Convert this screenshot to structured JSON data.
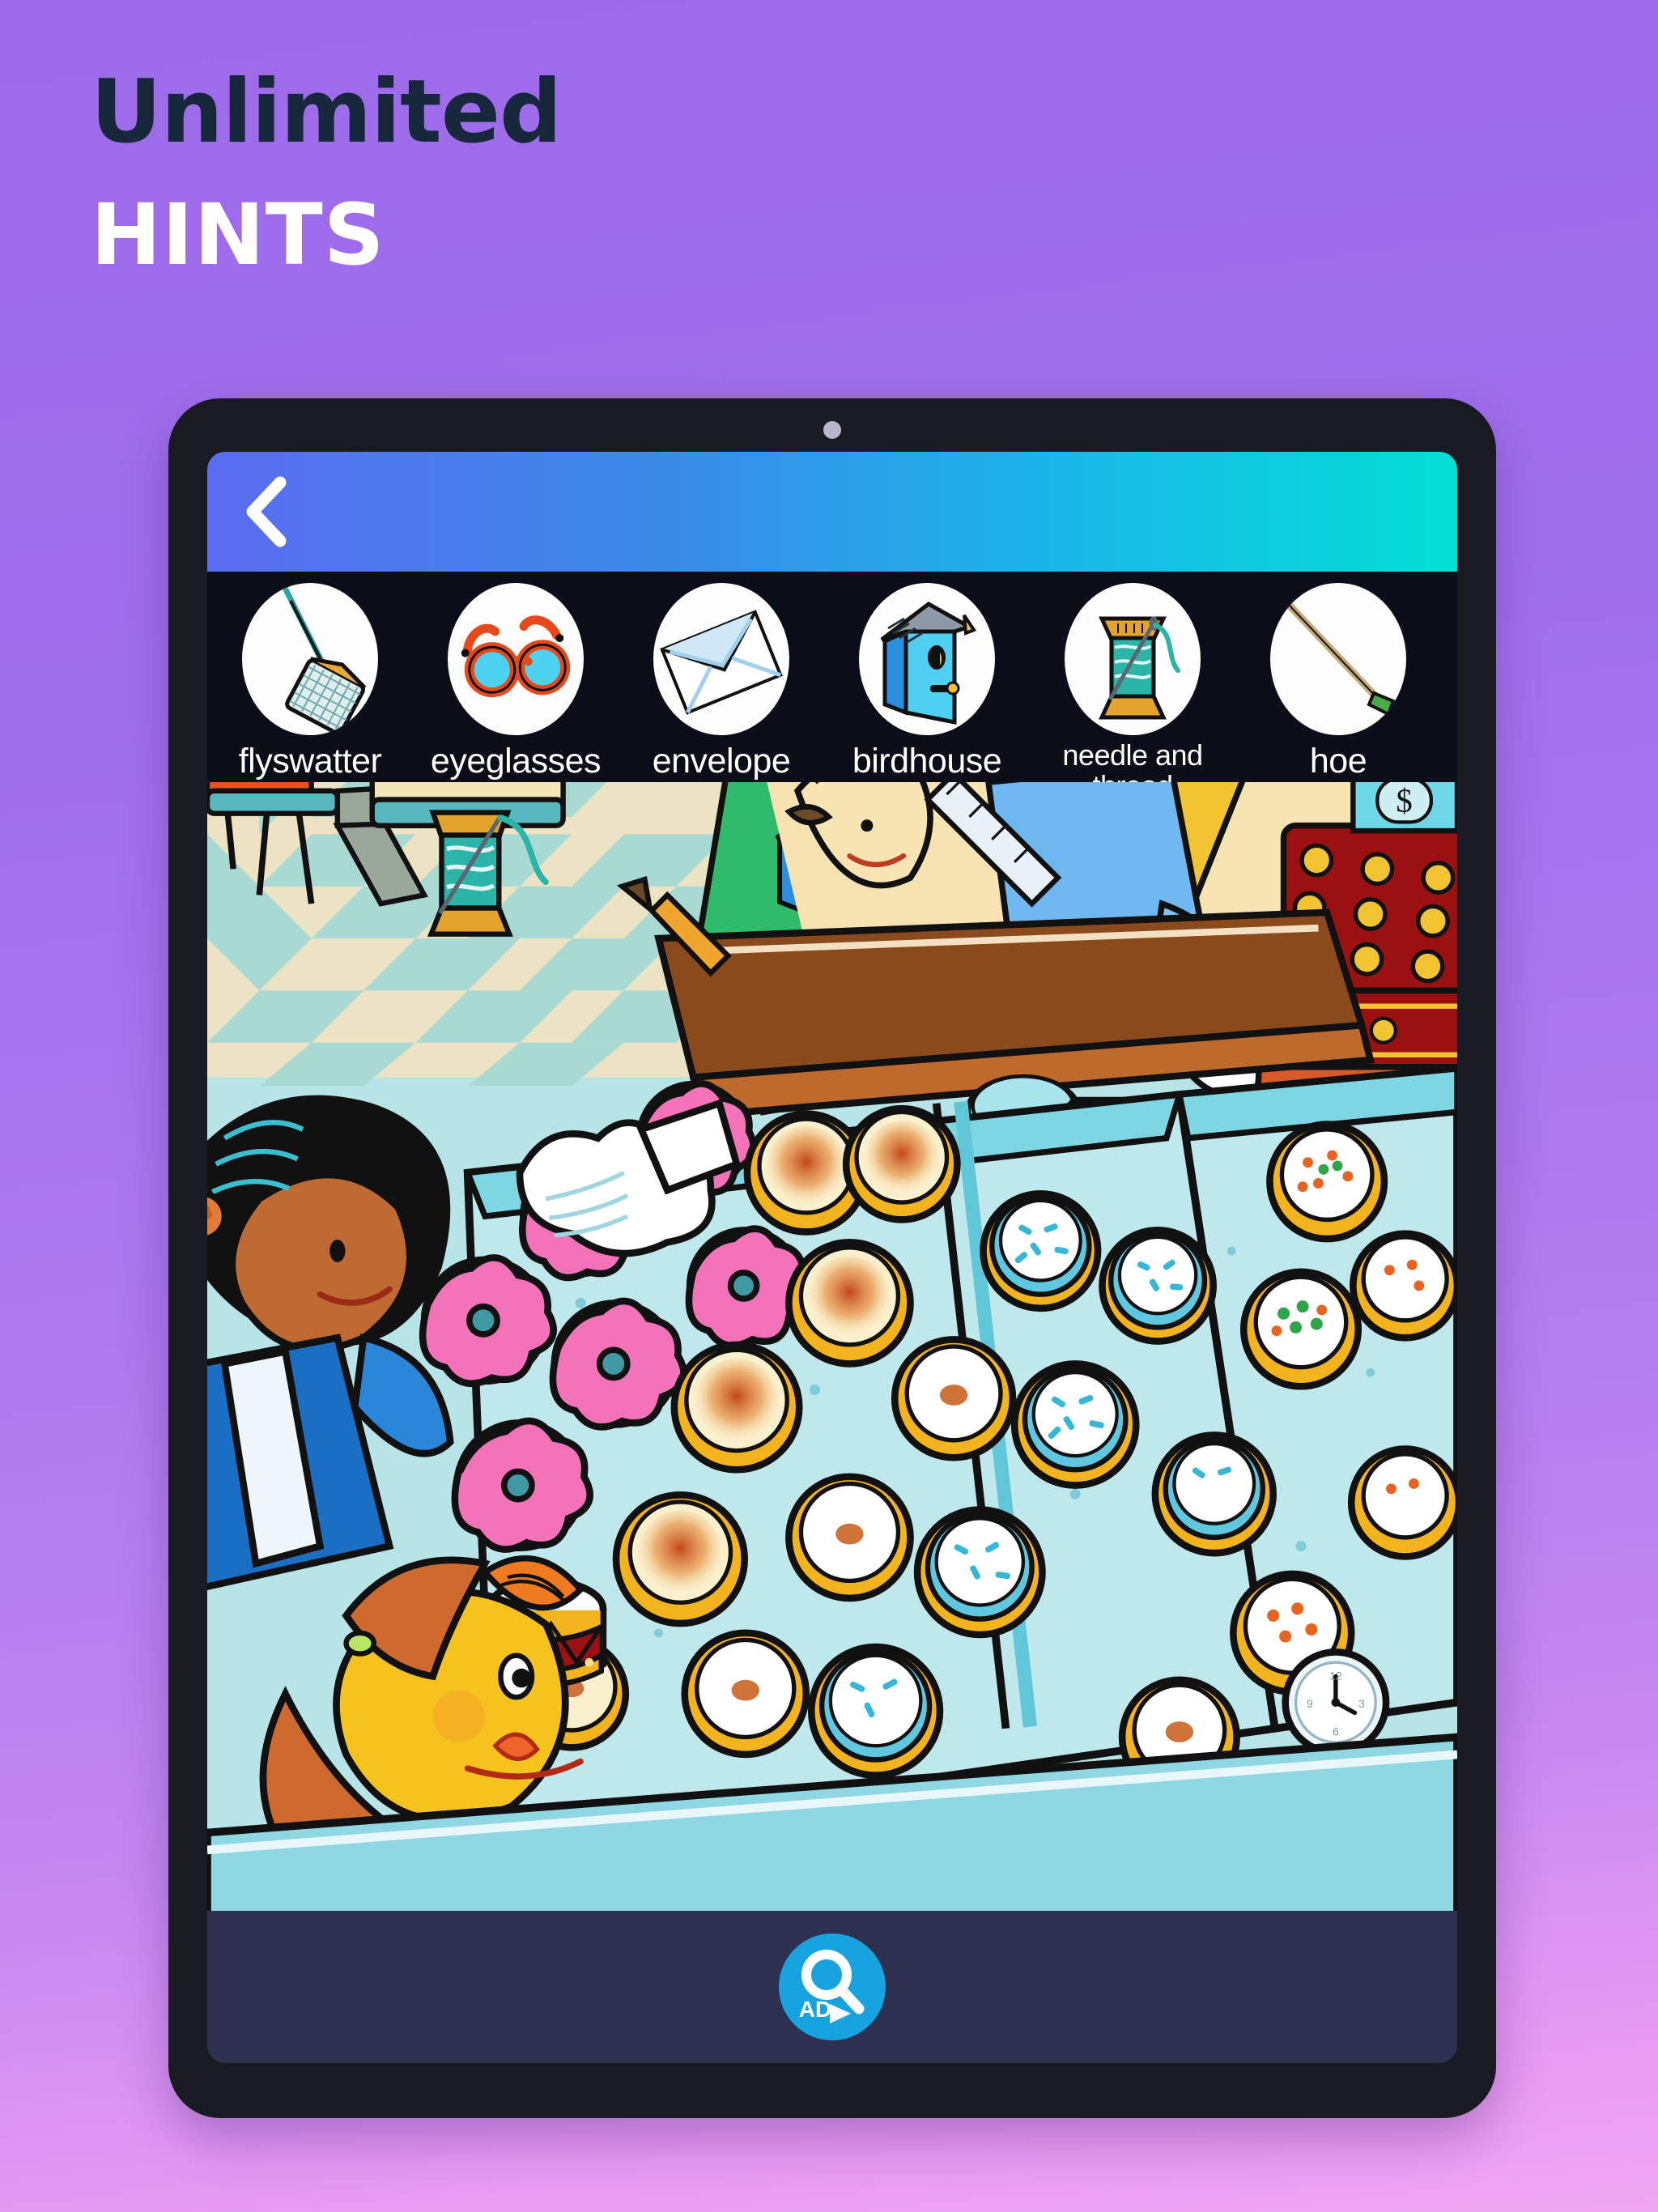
{
  "promo": {
    "line1": "Unlimited",
    "line2": "HINTS"
  },
  "colors": {
    "background_top": "#9d6bea",
    "background_bottom": "#f0a7f2",
    "headline_dark": "#18283c",
    "headline_light": "#ffffff",
    "tablet_body": "#191a22",
    "topbar_gradient_start": "#5a6cf0",
    "topbar_gradient_end": "#03dfd4",
    "hint_strip_bg": "#0b0e19",
    "bottom_bar_bg": "#2c3150",
    "hint_button_blue": "#17a2e0"
  },
  "topbar": {
    "back_label": "Back"
  },
  "hints": [
    {
      "label": "flyswatter",
      "icon": "flyswatter-icon"
    },
    {
      "label": "eyeglasses",
      "icon": "eyeglasses-icon"
    },
    {
      "label": "envelope",
      "icon": "envelope-icon"
    },
    {
      "label": "birdhouse",
      "icon": "birdhouse-icon"
    },
    {
      "label": "needle and thread",
      "icon": "needle-and-thread-icon"
    },
    {
      "label": "hoe",
      "icon": "hoe-icon"
    }
  ],
  "bottombar": {
    "hint_button_label": "AD"
  },
  "scene": {
    "description": "hidden object bakery illustration"
  }
}
